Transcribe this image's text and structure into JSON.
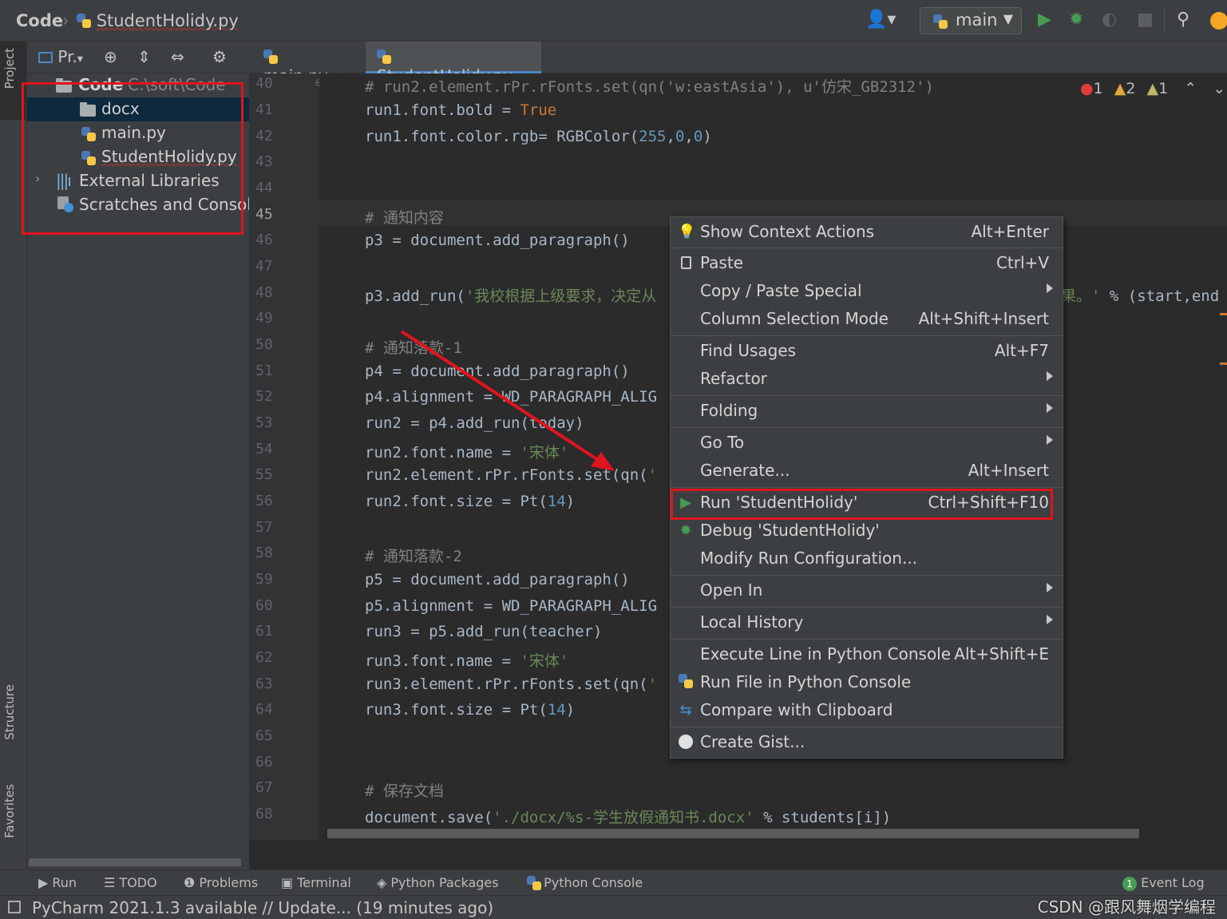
{
  "navbar": {
    "project": "Code",
    "file": "StudentHolidy.py",
    "run_config": "main"
  },
  "left_strip": {
    "project": "Project",
    "structure": "Structure",
    "favorites": "Favorites"
  },
  "project_panel": {
    "toolbar_label": "Pr.",
    "tree": [
      {
        "label": "Code",
        "path": "C:\\soft\\Code",
        "kind": "root-folder"
      },
      {
        "label": "docx",
        "kind": "folder",
        "selected": true
      },
      {
        "label": "main.py",
        "kind": "python-file"
      },
      {
        "label": "StudentHolidy.py",
        "kind": "python-file"
      },
      {
        "label": "External Libraries",
        "kind": "library"
      },
      {
        "label": "Scratches and Consoles",
        "kind": "scratches"
      }
    ]
  },
  "tabs": [
    {
      "label": "main.py",
      "active": false
    },
    {
      "label": "StudentHolidy.py",
      "active": true
    }
  ],
  "inspections": {
    "errors": "1",
    "warnings": "2",
    "weak_warnings": "1"
  },
  "editor": {
    "current_line": "45",
    "lines": [
      {
        "n": "40",
        "text": "# run2.element.rPr.rFonts.set(qn('w:eastAsia'), u'仿宋_GB2312')"
      },
      {
        "n": "41",
        "text": "run1.font.bold = True"
      },
      {
        "n": "42",
        "text": "run1.font.color.rgb= RGBColor(255,0,0)"
      },
      {
        "n": "43",
        "text": ""
      },
      {
        "n": "44",
        "text": ""
      },
      {
        "n": "45",
        "text": "# 通知内容"
      },
      {
        "n": "46",
        "text": "p3 = document.add_paragraph()"
      },
      {
        "n": "47",
        "text": ""
      },
      {
        "n": "48",
        "text": "p3.add_run('我校根据上级要求，决定从"
      },
      {
        "n": "48b",
        "text": "果。' % (start,end"
      },
      {
        "n": "49",
        "text": ""
      },
      {
        "n": "50",
        "text": "# 通知落款-1"
      },
      {
        "n": "51",
        "text": "p4 = document.add_paragraph()"
      },
      {
        "n": "52",
        "text": "p4.alignment = WD_PARAGRAPH_ALIG"
      },
      {
        "n": "53",
        "text": "run2 = p4.add_run(today)"
      },
      {
        "n": "54",
        "text": "run2.font.name = '宋体'"
      },
      {
        "n": "55",
        "text": "run2.element.rPr.rFonts.set(qn('"
      },
      {
        "n": "56",
        "text": "run2.font.size = Pt(14)"
      },
      {
        "n": "57",
        "text": ""
      },
      {
        "n": "58",
        "text": "# 通知落款-2"
      },
      {
        "n": "59",
        "text": "p5 = document.add_paragraph()"
      },
      {
        "n": "60",
        "text": "p5.alignment = WD_PARAGRAPH_ALIG"
      },
      {
        "n": "61",
        "text": "run3 = p5.add_run(teacher)"
      },
      {
        "n": "62",
        "text": "run3.font.name = '宋体'"
      },
      {
        "n": "63",
        "text": "run3.element.rPr.rFonts.set(qn('"
      },
      {
        "n": "64",
        "text": "run3.font.size = Pt(14)"
      },
      {
        "n": "65",
        "text": ""
      },
      {
        "n": "66",
        "text": ""
      },
      {
        "n": "67",
        "text": "# 保存文档"
      },
      {
        "n": "68",
        "text": "document.save('./docx/%s-学生放假通知书.docx' % students[i])"
      }
    ]
  },
  "context_menu": [
    {
      "label": "Show Context Actions",
      "shortcut": "Alt+Enter",
      "icon": "lightbulb-icon"
    },
    {
      "label": "Paste",
      "shortcut": "Ctrl+V",
      "icon": "clipboard-icon"
    },
    {
      "label": "Copy / Paste Special",
      "submenu": true
    },
    {
      "label": "Column Selection Mode",
      "shortcut": "Alt+Shift+Insert"
    },
    {
      "label": "Find Usages",
      "shortcut": "Alt+F7"
    },
    {
      "label": "Refactor",
      "submenu": true
    },
    {
      "label": "Folding",
      "submenu": true
    },
    {
      "label": "Go To",
      "submenu": true
    },
    {
      "label": "Generate...",
      "shortcut": "Alt+Insert"
    },
    {
      "label": "Run 'StudentHolidy'",
      "shortcut": "Ctrl+Shift+F10",
      "icon": "run-icon",
      "highlighted": true
    },
    {
      "label": "Debug 'StudentHolidy'",
      "icon": "debug-icon"
    },
    {
      "label": "Modify Run Configuration..."
    },
    {
      "label": "Open In",
      "submenu": true
    },
    {
      "label": "Local History",
      "submenu": true
    },
    {
      "label": "Execute Line in Python Console",
      "shortcut": "Alt+Shift+E"
    },
    {
      "label": "Run File in Python Console",
      "icon": "python-icon"
    },
    {
      "label": "Compare with Clipboard",
      "icon": "compare-icon"
    },
    {
      "label": "Create Gist...",
      "icon": "github-icon"
    }
  ],
  "bottom_tools": [
    {
      "label": "Run",
      "icon": "run-icon"
    },
    {
      "label": "TODO",
      "icon": "list-icon"
    },
    {
      "label": "Problems",
      "icon": "problems-icon"
    },
    {
      "label": "Terminal",
      "icon": "terminal-icon"
    },
    {
      "label": "Python Packages",
      "icon": "packages-icon"
    },
    {
      "label": "Python Console",
      "icon": "python-icon"
    },
    {
      "label": "Event Log",
      "icon": "event-log-icon",
      "badge": "1"
    }
  ],
  "status": {
    "text": "PyCharm 2021.1.3 available // Update... (19 minutes ago)"
  },
  "watermark": "CSDN @跟风舞烟学编程",
  "colors": {
    "annotation_red": "#e0141e",
    "run_green": "#499c54",
    "selection_blue": "#0d293e",
    "keyword": "#cc7832",
    "string": "#6a8759",
    "number": "#6897bb",
    "comment": "#808080"
  }
}
